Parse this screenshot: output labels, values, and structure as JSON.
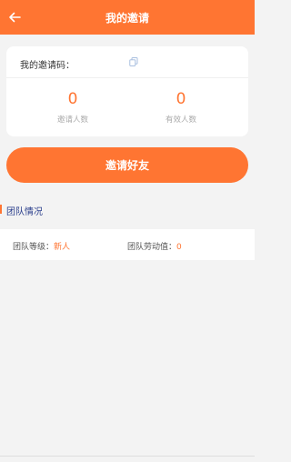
{
  "header": {
    "title": "我的邀请",
    "back_icon": "arrow-left-icon"
  },
  "invite_card": {
    "code_label": "我的邀请码：",
    "code_value": "",
    "copy_icon": "copy-icon",
    "stats": [
      {
        "value": "0",
        "label": "邀请人数"
      },
      {
        "value": "0",
        "label": "有效人数"
      }
    ]
  },
  "invite_button": {
    "label": "邀请好友"
  },
  "team_section": {
    "title": "团队情况",
    "level_label": "团队等级：",
    "level_value": "新人",
    "labor_label": "团队劳动值：",
    "labor_value": "0"
  },
  "colors": {
    "accent": "#ff7532",
    "section_title": "#2b3f8c",
    "background": "#f3f3f3"
  }
}
